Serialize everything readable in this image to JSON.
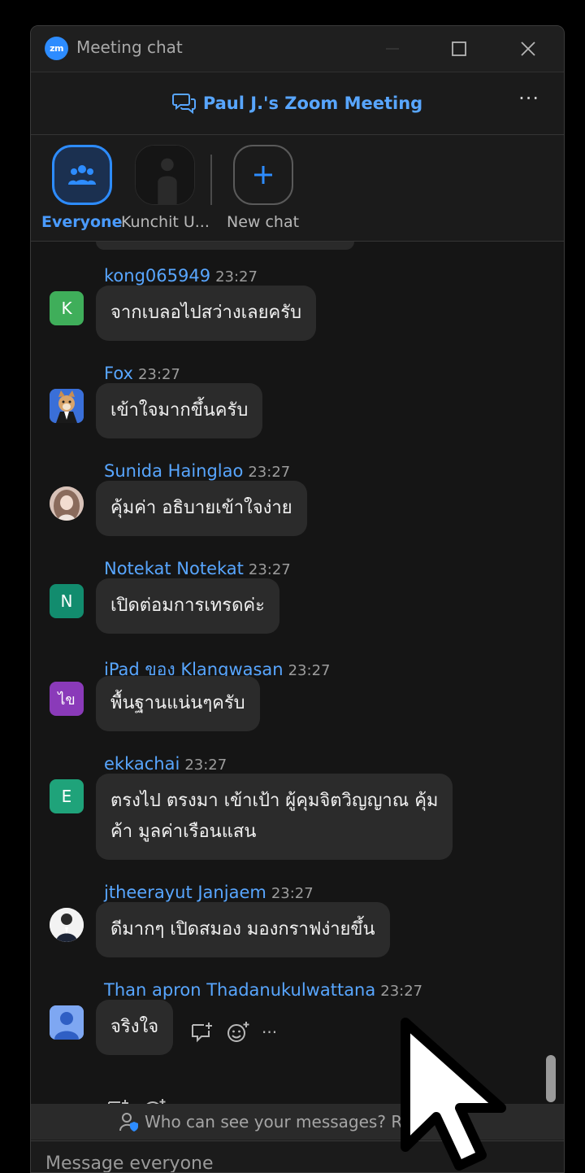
{
  "window": {
    "app_logo": "zm",
    "title": "Meeting chat"
  },
  "header": {
    "meeting_title": "Paul J.'s Zoom Meeting",
    "more": "···"
  },
  "tabs": [
    {
      "label": "Everyone",
      "active": true,
      "icon": "people-icon"
    },
    {
      "label": "Kunchit U...",
      "active": false,
      "icon": "profile-photo"
    },
    {
      "label": "New chat",
      "active": false,
      "icon": "plus-icon"
    }
  ],
  "messages": [
    {
      "sender": "kong065949",
      "time": "23:27",
      "text": "จากเบลอไปสว่างเลยครับ",
      "avatar_letter": "K",
      "avatar_color": "#3fae5a"
    },
    {
      "sender": "Fox",
      "time": "23:27",
      "text": "เข้าใจมากขึ้นครับ",
      "avatar_letter": "",
      "avatar_color": "#3a6fd8"
    },
    {
      "sender": "Sunida Hainglao",
      "time": "23:27",
      "text": "คุ้มค่า อธิบายเข้าใจง่าย",
      "avatar_letter": "",
      "avatar_color": "#c7a9a0"
    },
    {
      "sender": "Notekat Notekat",
      "time": "23:27",
      "text": "เปิดต่อมการเทรดค่ะ",
      "avatar_letter": "N",
      "avatar_color": "#128c6e"
    },
    {
      "sender": "iPad ของ Klangwasan",
      "time": "23:27",
      "text": "พื้นฐานแน่นๆครับ",
      "avatar_letter": "ไข",
      "avatar_color": "#8a3ab9"
    },
    {
      "sender": "ekkachai",
      "time": "23:27",
      "text": "ตรงไป ตรงมา เข้าเป้า ผู้คุมจิตวิญญาณ คุ้ม\nค้า มูลค่าเรือนแสน",
      "avatar_letter": "E",
      "avatar_color": "#1fa37a"
    },
    {
      "sender": "jtheerayut Janjaem",
      "time": "23:27",
      "text": "ดีมากๆ เปิดสมอง มองกราฟง่ายขึ้น",
      "avatar_letter": "",
      "avatar_color": "#f2f2f2"
    },
    {
      "sender": "Than apron Thadanukulwattana",
      "time": "23:27",
      "text": "จริงใจ",
      "avatar_letter": "",
      "avatar_color": "#6e9ef0"
    }
  ],
  "actions": {
    "more": "···"
  },
  "privacy": {
    "text": "Who can see your messages? Rec"
  },
  "composer": {
    "placeholder": "Message everyone"
  }
}
